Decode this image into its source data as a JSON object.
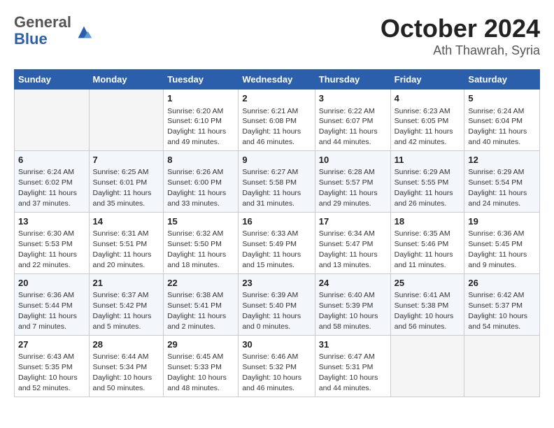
{
  "header": {
    "logo": {
      "general": "General",
      "blue": "Blue"
    },
    "month": "October 2024",
    "location": "Ath Thawrah, Syria"
  },
  "weekdays": [
    "Sunday",
    "Monday",
    "Tuesday",
    "Wednesday",
    "Thursday",
    "Friday",
    "Saturday"
  ],
  "weeks": [
    [
      {
        "day": "",
        "empty": true
      },
      {
        "day": "",
        "empty": true
      },
      {
        "day": "1",
        "sunrise": "6:20 AM",
        "sunset": "6:10 PM",
        "daylight": "11 hours and 49 minutes."
      },
      {
        "day": "2",
        "sunrise": "6:21 AM",
        "sunset": "6:08 PM",
        "daylight": "11 hours and 46 minutes."
      },
      {
        "day": "3",
        "sunrise": "6:22 AM",
        "sunset": "6:07 PM",
        "daylight": "11 hours and 44 minutes."
      },
      {
        "day": "4",
        "sunrise": "6:23 AM",
        "sunset": "6:05 PM",
        "daylight": "11 hours and 42 minutes."
      },
      {
        "day": "5",
        "sunrise": "6:24 AM",
        "sunset": "6:04 PM",
        "daylight": "11 hours and 40 minutes."
      }
    ],
    [
      {
        "day": "6",
        "sunrise": "6:24 AM",
        "sunset": "6:02 PM",
        "daylight": "11 hours and 37 minutes."
      },
      {
        "day": "7",
        "sunrise": "6:25 AM",
        "sunset": "6:01 PM",
        "daylight": "11 hours and 35 minutes."
      },
      {
        "day": "8",
        "sunrise": "6:26 AM",
        "sunset": "6:00 PM",
        "daylight": "11 hours and 33 minutes."
      },
      {
        "day": "9",
        "sunrise": "6:27 AM",
        "sunset": "5:58 PM",
        "daylight": "11 hours and 31 minutes."
      },
      {
        "day": "10",
        "sunrise": "6:28 AM",
        "sunset": "5:57 PM",
        "daylight": "11 hours and 29 minutes."
      },
      {
        "day": "11",
        "sunrise": "6:29 AM",
        "sunset": "5:55 PM",
        "daylight": "11 hours and 26 minutes."
      },
      {
        "day": "12",
        "sunrise": "6:29 AM",
        "sunset": "5:54 PM",
        "daylight": "11 hours and 24 minutes."
      }
    ],
    [
      {
        "day": "13",
        "sunrise": "6:30 AM",
        "sunset": "5:53 PM",
        "daylight": "11 hours and 22 minutes."
      },
      {
        "day": "14",
        "sunrise": "6:31 AM",
        "sunset": "5:51 PM",
        "daylight": "11 hours and 20 minutes."
      },
      {
        "day": "15",
        "sunrise": "6:32 AM",
        "sunset": "5:50 PM",
        "daylight": "11 hours and 18 minutes."
      },
      {
        "day": "16",
        "sunrise": "6:33 AM",
        "sunset": "5:49 PM",
        "daylight": "11 hours and 15 minutes."
      },
      {
        "day": "17",
        "sunrise": "6:34 AM",
        "sunset": "5:47 PM",
        "daylight": "11 hours and 13 minutes."
      },
      {
        "day": "18",
        "sunrise": "6:35 AM",
        "sunset": "5:46 PM",
        "daylight": "11 hours and 11 minutes."
      },
      {
        "day": "19",
        "sunrise": "6:36 AM",
        "sunset": "5:45 PM",
        "daylight": "11 hours and 9 minutes."
      }
    ],
    [
      {
        "day": "20",
        "sunrise": "6:36 AM",
        "sunset": "5:44 PM",
        "daylight": "11 hours and 7 minutes."
      },
      {
        "day": "21",
        "sunrise": "6:37 AM",
        "sunset": "5:42 PM",
        "daylight": "11 hours and 5 minutes."
      },
      {
        "day": "22",
        "sunrise": "6:38 AM",
        "sunset": "5:41 PM",
        "daylight": "11 hours and 2 minutes."
      },
      {
        "day": "23",
        "sunrise": "6:39 AM",
        "sunset": "5:40 PM",
        "daylight": "11 hours and 0 minutes."
      },
      {
        "day": "24",
        "sunrise": "6:40 AM",
        "sunset": "5:39 PM",
        "daylight": "10 hours and 58 minutes."
      },
      {
        "day": "25",
        "sunrise": "6:41 AM",
        "sunset": "5:38 PM",
        "daylight": "10 hours and 56 minutes."
      },
      {
        "day": "26",
        "sunrise": "6:42 AM",
        "sunset": "5:37 PM",
        "daylight": "10 hours and 54 minutes."
      }
    ],
    [
      {
        "day": "27",
        "sunrise": "6:43 AM",
        "sunset": "5:35 PM",
        "daylight": "10 hours and 52 minutes."
      },
      {
        "day": "28",
        "sunrise": "6:44 AM",
        "sunset": "5:34 PM",
        "daylight": "10 hours and 50 minutes."
      },
      {
        "day": "29",
        "sunrise": "6:45 AM",
        "sunset": "5:33 PM",
        "daylight": "10 hours and 48 minutes."
      },
      {
        "day": "30",
        "sunrise": "6:46 AM",
        "sunset": "5:32 PM",
        "daylight": "10 hours and 46 minutes."
      },
      {
        "day": "31",
        "sunrise": "6:47 AM",
        "sunset": "5:31 PM",
        "daylight": "10 hours and 44 minutes."
      },
      {
        "day": "",
        "empty": true
      },
      {
        "day": "",
        "empty": true
      }
    ]
  ]
}
